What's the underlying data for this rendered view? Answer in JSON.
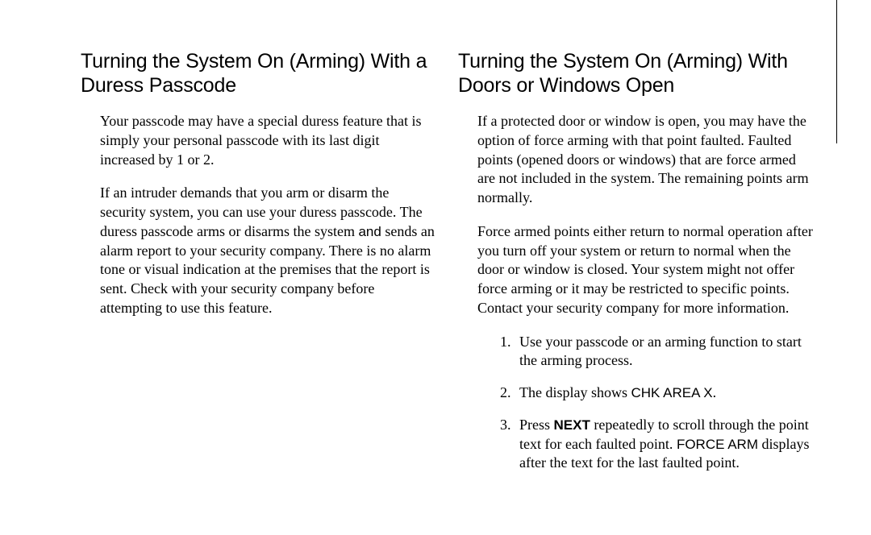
{
  "left": {
    "title": "Turning the System On (Arming) With a Duress Passcode",
    "p1": "Your passcode may have a special duress feature that is simply your personal passcode with its last digit increased by 1 or 2.",
    "p2a": "If an intruder demands that you arm or disarm the security system, you can use your duress passcode. The duress passcode arms or disarms the system ",
    "p2_and": "and",
    "p2b": " sends an alarm report to your security company. There is no alarm tone or visual indication at the premises that the report is sent. Check with your security company before attempting to use this feature."
  },
  "right": {
    "title": "Turning the System On (Arming) With Doors or Windows Open",
    "p1": "If a protected door or window is open, you may have the option of  force arming  with that point faulted. Faulted points (opened doors or windows) that are force armed are not included in the system. The remaining points arm normally.",
    "p2": "Force armed points either return to normal operation after you turn off your system or return to normal when the door or window is closed. Your system might not offer force arming or it may be restricted to specific points. Contact your security company for more information.",
    "step1": "Use your passcode or an arming function to start the arming process.",
    "step2a": "The display shows ",
    "step2_chk": "CHK AREA X",
    "step2b": ".",
    "step3a": "Press ",
    "step3_next": "NEXT",
    "step3b": "   repeatedly to scroll through the point text for each faulted point. ",
    "step3_force": "FORCE ARM",
    "step3c": " displays after the text for the last faulted point."
  }
}
